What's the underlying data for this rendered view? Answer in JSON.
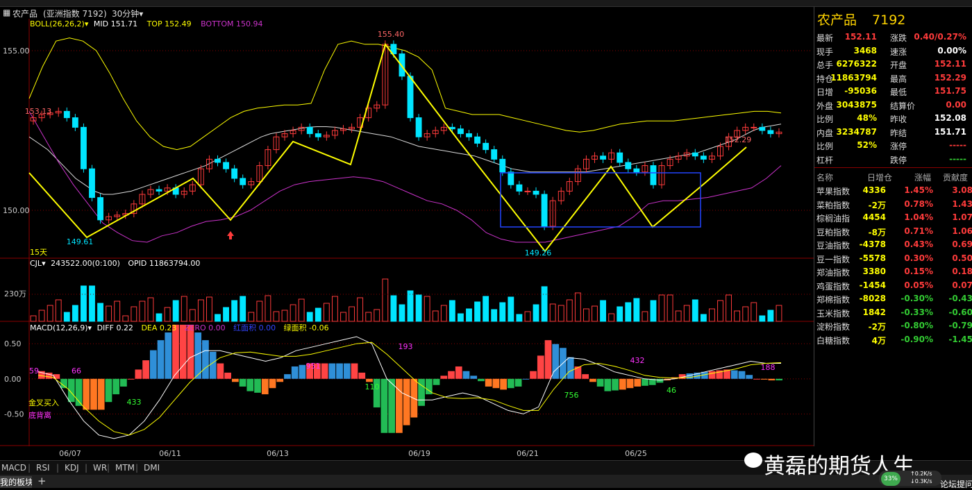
{
  "window": {
    "title": "农产品",
    "subtitle": "(亚洲指数 7192)",
    "period": "30分钟"
  },
  "colors": {
    "up": "#ff3b3b",
    "down": "#00e5ff",
    "yellow": "#ffff00",
    "magenta": "#cc33cc",
    "white": "#ffffff",
    "green": "#33cc33"
  },
  "boll": {
    "name": "BOLL(26,26,2)",
    "mid": "MID 151.71",
    "top": "TOP 152.49",
    "bottom": "BOTTOM 150.94"
  },
  "price_axis": {
    "labels": [
      "155.00",
      "150.00"
    ],
    "values": [
      155.0,
      150.0
    ],
    "range": [
      148.5,
      156.0
    ]
  },
  "annotations": {
    "high": "155.40",
    "low_left": "149.61",
    "low_right": "149.26",
    "left_mark": "153.13",
    "right_mark": "152.29",
    "days": "15天"
  },
  "volume": {
    "name": "CJL",
    "value": "243522.00(0:100)",
    "opid": "OPID 11863794.00",
    "axis_label": "230万"
  },
  "macd": {
    "name": "MACD(12,26,9)",
    "diff": "DIFF 0.22",
    "dea": "DEA 0.23",
    "zero": "ZERO 0.00",
    "red_area": "红面积 0.00",
    "green_area": "绿面积 -0.06",
    "axis_labels": [
      "0.50",
      "0.00",
      "-0.50"
    ],
    "axis_values": [
      0.5,
      0.0,
      -0.5
    ],
    "range": [
      -0.95,
      0.65
    ],
    "area_labels": [
      "59",
      "66",
      "433",
      "951",
      "110",
      "193",
      "756",
      "432",
      "46",
      "188"
    ],
    "signals": [
      "金叉买入",
      "底背离"
    ]
  },
  "dates": [
    "06/07",
    "06/11",
    "06/13",
    "06/19",
    "06/21",
    "06/25"
  ],
  "chart_data": {
    "type": "line",
    "title": "农产品",
    "series": [
      {
        "name": "close",
        "values": [
          152.9,
          153.0,
          153.05,
          153.1,
          152.9,
          152.6,
          151.3,
          150.4,
          149.7,
          149.8,
          149.85,
          149.9,
          150.2,
          150.5,
          150.65,
          150.6,
          150.7,
          150.5,
          150.6,
          150.8,
          151.3,
          151.6,
          151.5,
          151.3,
          151.0,
          150.8,
          150.9,
          151.4,
          151.9,
          152.3,
          152.4,
          152.5,
          152.6,
          152.4,
          152.3,
          152.35,
          152.5,
          152.55,
          152.6,
          152.9,
          153.2,
          153.3,
          155.2,
          154.9,
          154.2,
          152.9,
          152.3,
          152.4,
          152.5,
          152.6,
          152.55,
          152.4,
          152.3,
          152.1,
          151.9,
          151.6,
          151.2,
          150.8,
          150.6,
          150.6,
          150.5,
          149.5,
          150.3,
          150.6,
          150.9,
          151.3,
          151.6,
          151.7,
          151.6,
          151.8,
          151.5,
          151.3,
          151.2,
          151.4,
          150.8,
          151.4,
          151.6,
          151.7,
          151.8,
          151.7,
          151.6,
          151.7,
          152.0,
          152.3,
          152.5,
          152.6,
          152.6,
          152.5,
          152.4,
          152.45
        ]
      },
      {
        "name": "MID",
        "values": [
          152.3,
          152.1,
          151.9,
          151.6,
          151.3,
          151.0,
          150.8,
          150.6,
          150.5,
          150.5,
          150.55,
          150.6,
          150.7,
          150.8,
          150.9,
          151.0,
          151.1,
          151.2,
          151.3,
          151.4,
          151.55,
          151.7,
          151.85,
          152.0,
          152.15,
          152.3,
          152.4,
          152.45,
          152.5,
          152.55,
          152.6,
          152.62,
          152.62,
          152.6,
          152.55,
          152.5,
          152.45,
          152.4,
          152.35,
          152.3,
          152.2,
          152.1,
          152.0,
          151.95,
          151.9,
          151.85,
          151.8,
          151.75,
          151.7,
          151.6,
          151.5,
          151.4,
          151.3,
          151.25,
          151.2,
          151.2,
          151.2,
          151.2,
          151.2,
          151.2,
          151.2,
          151.25,
          151.3,
          151.35,
          151.4,
          151.45,
          151.5,
          151.55,
          151.6,
          151.65,
          151.7,
          151.75,
          151.8,
          151.9,
          152.0,
          152.1,
          152.2,
          152.35,
          152.5,
          152.6,
          152.65,
          152.7
        ]
      },
      {
        "name": "TOP",
        "values": [
          153.5,
          154.5,
          155.3,
          155.4,
          155.3,
          155.0,
          154.3,
          153.5,
          152.8,
          152.3,
          152.0,
          151.9,
          152.0,
          152.3,
          152.6,
          152.9,
          153.1,
          153.2,
          153.25,
          153.3,
          153.3,
          153.35,
          154.4,
          155.2,
          155.3,
          155.2,
          155.2,
          155.1,
          155.0,
          154.8,
          154.4,
          153.2,
          153.1,
          153.0,
          153.0,
          153.0,
          152.9,
          152.8,
          152.7,
          152.6,
          152.5,
          152.45,
          152.5,
          152.6,
          152.7,
          152.75,
          152.8,
          152.8,
          152.8,
          152.85,
          152.9,
          152.95,
          153.0,
          153.05,
          153.1,
          153.1,
          153.05
        ]
      },
      {
        "name": "BOTTOM",
        "values": [
          153.1,
          152.3,
          151.5,
          150.8,
          150.2,
          149.6,
          149.3,
          149.05,
          149.0,
          149.2,
          149.3,
          149.5,
          149.65,
          149.7,
          149.8,
          150.0,
          150.3,
          150.6,
          150.8,
          150.9,
          150.95,
          151.0,
          151.05,
          151.0,
          150.9,
          150.7,
          150.5,
          150.3,
          150.2,
          150.0,
          149.7,
          149.3,
          149.1,
          149.0,
          149.0,
          149.0,
          149.1,
          149.2,
          149.3,
          149.4,
          149.5,
          149.8,
          150.2,
          150.3,
          150.3,
          150.35,
          150.4,
          150.5,
          150.6,
          150.7,
          151.0,
          151.4
        ]
      },
      {
        "name": "DIFF",
        "values": [
          0.1,
          0.05,
          -0.3,
          -0.6,
          -0.8,
          -0.85,
          -0.8,
          -0.6,
          -0.3,
          0.05,
          0.3,
          0.4,
          0.4,
          0.35,
          0.3,
          0.25,
          0.3,
          0.4,
          0.45,
          0.5,
          0.55,
          0.6,
          0.5,
          0.0,
          -0.2,
          -0.3,
          -0.3,
          -0.25,
          -0.2,
          -0.25,
          -0.35,
          -0.45,
          -0.5,
          -0.4,
          0.1,
          0.3,
          0.28,
          0.2,
          0.1,
          0.05,
          0.0,
          -0.02,
          0.0,
          0.05,
          0.1,
          0.15,
          0.2,
          0.25,
          0.22,
          0.22
        ]
      },
      {
        "name": "DEA",
        "values": [
          0.05,
          0.02,
          -0.15,
          -0.4,
          -0.6,
          -0.75,
          -0.8,
          -0.72,
          -0.55,
          -0.3,
          -0.05,
          0.15,
          0.3,
          0.37,
          0.38,
          0.35,
          0.32,
          0.32,
          0.35,
          0.4,
          0.45,
          0.5,
          0.52,
          0.35,
          0.15,
          -0.05,
          -0.2,
          -0.27,
          -0.28,
          -0.27,
          -0.3,
          -0.38,
          -0.45,
          -0.45,
          -0.15,
          0.1,
          0.2,
          0.22,
          0.18,
          0.12,
          0.05,
          0.02,
          0.01,
          0.02,
          0.06,
          0.1,
          0.14,
          0.2,
          0.22,
          0.23
        ]
      }
    ],
    "xlabel": "",
    "ylabel": "",
    "ylim": [
      148.5,
      156.0
    ]
  },
  "quote": {
    "title": "农产品",
    "code": "7192",
    "rows": [
      {
        "l1": "最新",
        "v1": "152.11",
        "c1": "#ff3b3b",
        "l2": "涨跌",
        "v2": "0.40/0.27%",
        "c2": "#ff3b3b"
      },
      {
        "l1": "现手",
        "v1": "3468",
        "c1": "#ffff00",
        "l2": "速涨",
        "v2": "0.00%",
        "c2": "#ffffff"
      },
      {
        "l1": "总手",
        "v1": "6276322",
        "c1": "#ffff00",
        "l2": "开盘",
        "v2": "152.11",
        "c2": "#ff3b3b"
      },
      {
        "l1": "持仓",
        "v1": "11863794",
        "c1": "#ffff00",
        "l2": "最高",
        "v2": "152.29",
        "c2": "#ff3b3b"
      },
      {
        "l1": "日增",
        "v1": "-95036",
        "c1": "#ffff00",
        "l2": "最低",
        "v2": "151.75",
        "c2": "#ff3b3b"
      },
      {
        "l1": "外盘",
        "v1": "3043875",
        "c1": "#ffff00",
        "l2": "结算价",
        "v2": "0.00",
        "c2": "#ff3b3b"
      },
      {
        "l1": "比例",
        "v1": "48%",
        "c1": "#ffff00",
        "l2": "昨收",
        "v2": "152.08",
        "c2": "#ffffff"
      },
      {
        "l1": "内盘",
        "v1": "3234787",
        "c1": "#ffff00",
        "l2": "昨结",
        "v2": "151.71",
        "c2": "#ffffff"
      },
      {
        "l1": "比例",
        "v1": "52%",
        "c1": "#ffff00",
        "l2": "涨停",
        "v2": "-----",
        "c2": "#ff3b3b"
      },
      {
        "l1": "杠杆",
        "v1": "",
        "c1": "#ffff00",
        "l2": "跌停",
        "v2": "-----",
        "c2": "#33cc33"
      }
    ]
  },
  "index_table": {
    "headers": [
      "名称",
      "日增仓",
      "涨幅",
      "贡献度"
    ],
    "rows": [
      {
        "name": "苹果指数",
        "add": "4336",
        "chg": "1.45%",
        "con": "3.08",
        "up": true
      },
      {
        "name": "菜粕指数",
        "add": "-2万",
        "chg": "0.78%",
        "con": "1.43",
        "up": true
      },
      {
        "name": "棕榈油指",
        "add": "4454",
        "chg": "1.04%",
        "con": "1.07",
        "up": true
      },
      {
        "name": "豆粕指数",
        "add": "-8万",
        "chg": "0.71%",
        "con": "1.06",
        "up": true
      },
      {
        "name": "豆油指数",
        "add": "-4378",
        "chg": "0.43%",
        "con": "0.69",
        "up": true
      },
      {
        "name": "豆一指数",
        "add": "-5578",
        "chg": "0.30%",
        "con": "0.50",
        "up": true
      },
      {
        "name": "郑油指数",
        "add": "3380",
        "chg": "0.15%",
        "con": "0.18",
        "up": true
      },
      {
        "name": "鸡蛋指数",
        "add": "-1454",
        "chg": "0.05%",
        "con": "0.07",
        "up": true
      },
      {
        "name": "郑棉指数",
        "add": "-8028",
        "chg": "-0.30%",
        "con": "-0.43",
        "up": false
      },
      {
        "name": "玉米指数",
        "add": "1842",
        "chg": "-0.33%",
        "con": "-0.60",
        "up": false
      },
      {
        "name": "淀粉指数",
        "add": "-2万",
        "chg": "-0.80%",
        "con": "-0.79",
        "up": false
      },
      {
        "name": "白糖指数",
        "add": "4万",
        "chg": "-0.90%",
        "con": "-1.45",
        "up": false
      }
    ]
  },
  "indicator_tabs": [
    "MACD",
    "RSI",
    "KDJ",
    "WR",
    "MTM",
    "DMI"
  ],
  "bottom": {
    "tab": "我的板块",
    "plus": "+"
  },
  "watermark": "黄磊的期货人生",
  "network": {
    "percent": "33%",
    "up": "0.2K/s",
    "down": "0.3K/s",
    "forum": "论坛提问"
  }
}
